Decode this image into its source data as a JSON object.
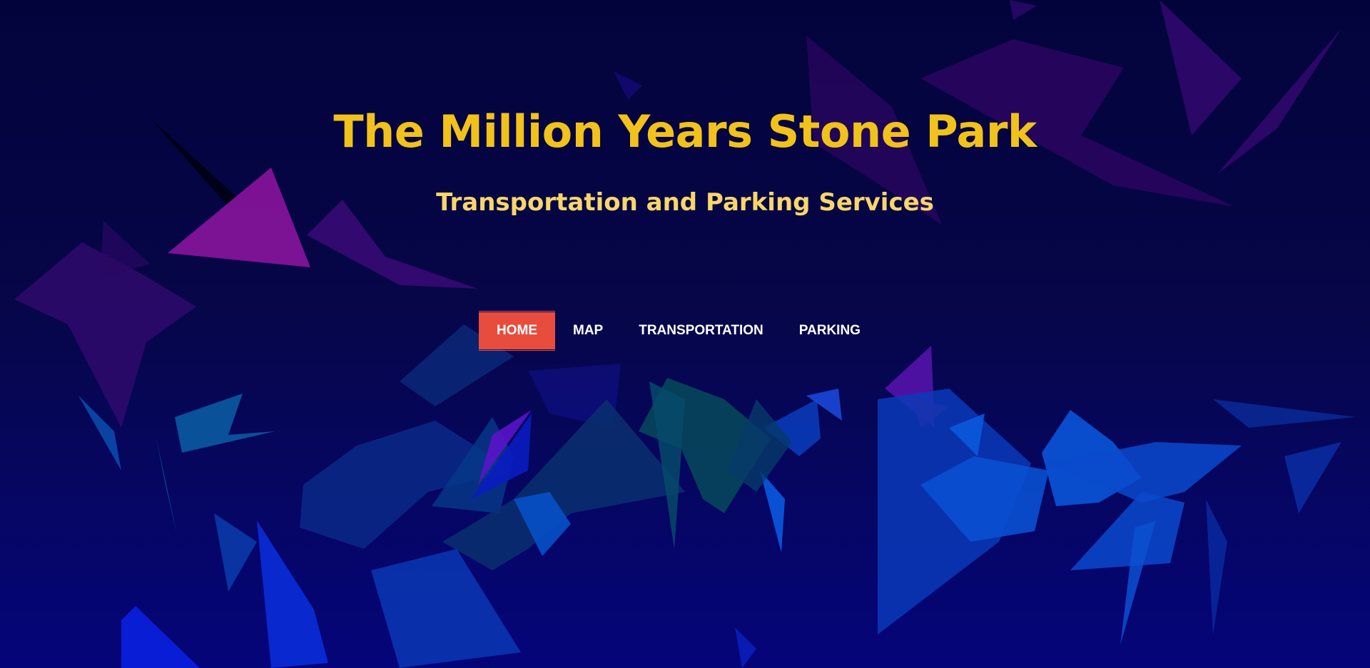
{
  "colors": {
    "title": "#f1c21b",
    "subtitle": "#f8d66a",
    "nav_active_bg": "#e84c3d",
    "nav_text": "#ffffff",
    "background": "#03033c"
  },
  "hero": {
    "title": "The Million Years Stone Park",
    "subtitle": "Transportation and Parking Services"
  },
  "nav": {
    "active_index": 0,
    "items": [
      {
        "label": "HOME"
      },
      {
        "label": "MAP"
      },
      {
        "label": "TRANSPORTATION"
      },
      {
        "label": "PARKING"
      }
    ]
  }
}
